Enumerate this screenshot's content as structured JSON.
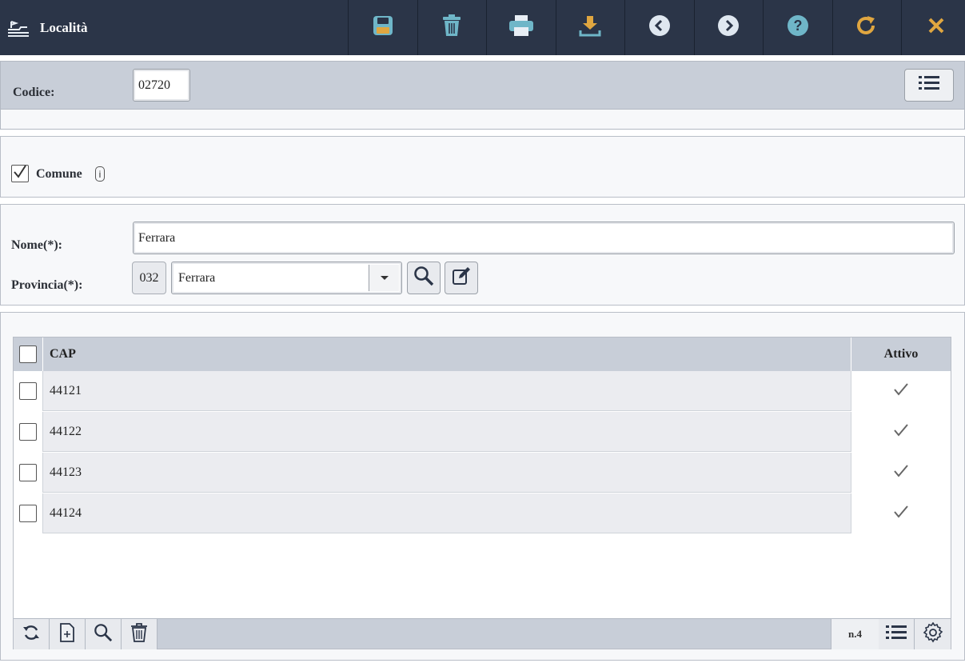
{
  "window": {
    "title": "Località",
    "app_icon": "ship-landing-icon"
  },
  "toolbar": {
    "buttons": [
      {
        "name": "save-button",
        "icon": "floppy-disk-icon",
        "color": "#6fb6c8"
      },
      {
        "name": "delete-button",
        "icon": "trash-icon",
        "color": "#6fb6c8"
      },
      {
        "name": "print-button",
        "icon": "printer-icon",
        "color": "#6fb6c8"
      },
      {
        "name": "download-button",
        "icon": "download-icon",
        "color": "#e0a640"
      },
      {
        "name": "previous-button",
        "icon": "chevron-left-circle-icon",
        "color": "#dfe7f0"
      },
      {
        "name": "next-button",
        "icon": "chevron-right-circle-icon",
        "color": "#dfe7f0"
      },
      {
        "name": "help-button",
        "icon": "question-circle-icon",
        "color": "#6fb6c8"
      },
      {
        "name": "refresh-button",
        "icon": "redo-icon",
        "color": "#e0a640"
      },
      {
        "name": "close-button",
        "icon": "close-icon",
        "color": "#e0a640"
      }
    ]
  },
  "header": {
    "codice_label": "Codice:",
    "codice_value": "02720"
  },
  "comune": {
    "label": "Comune",
    "checked": true,
    "info": "i"
  },
  "form": {
    "nome_label": "Nome(*):",
    "nome_value": "Ferrara",
    "provincia_label": "Provincia(*):",
    "provincia_code": "032",
    "provincia_value": "Ferrara"
  },
  "grid": {
    "columns": [
      "CAP",
      "Attivo"
    ],
    "rows": [
      {
        "cap": "44121",
        "attivo": true
      },
      {
        "cap": "44122",
        "attivo": true
      },
      {
        "cap": "44123",
        "attivo": true
      },
      {
        "cap": "44124",
        "attivo": true
      }
    ],
    "count_label": "n.4"
  }
}
